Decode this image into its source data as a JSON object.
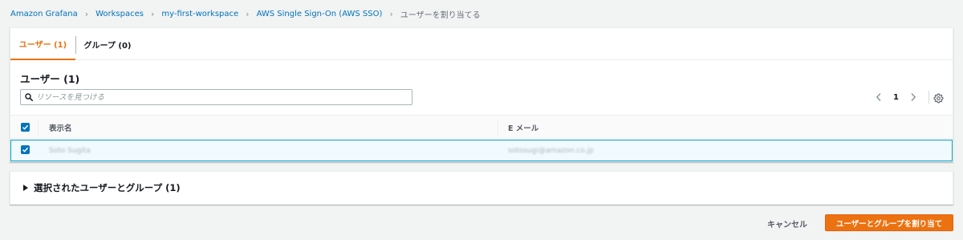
{
  "breadcrumb": {
    "items": [
      "Amazon Grafana",
      "Workspaces",
      "my-first-workspace",
      "AWS Single Sign-On (AWS SSO)"
    ],
    "current": "ユーザーを割り当てる"
  },
  "tabs": [
    {
      "label": "ユーザー (1)",
      "active": true
    },
    {
      "label": "グループ (0)",
      "active": false
    }
  ],
  "users_section": {
    "title": "ユーザー (1)",
    "search": {
      "placeholder": "リソースを見つける",
      "value": ""
    },
    "pagination": {
      "current_page": "1"
    },
    "columns": [
      "表示名",
      "E メール"
    ],
    "rows": [
      {
        "display_name": "Soto Sugita",
        "email": "sotosugi@amazon.co.jp",
        "selected": true
      }
    ],
    "select_all_checked": true
  },
  "selected_section": {
    "title": "選択されたユーザーとグループ (1)",
    "expanded": false
  },
  "footer": {
    "cancel_label": "キャンセル",
    "assign_label": "ユーザーとグループを割り当て"
  },
  "colors": {
    "accent": "#ec7211",
    "link": "#0073bb",
    "selected_row_bg": "#f1faff",
    "selected_row_border": "#00a1c9"
  }
}
